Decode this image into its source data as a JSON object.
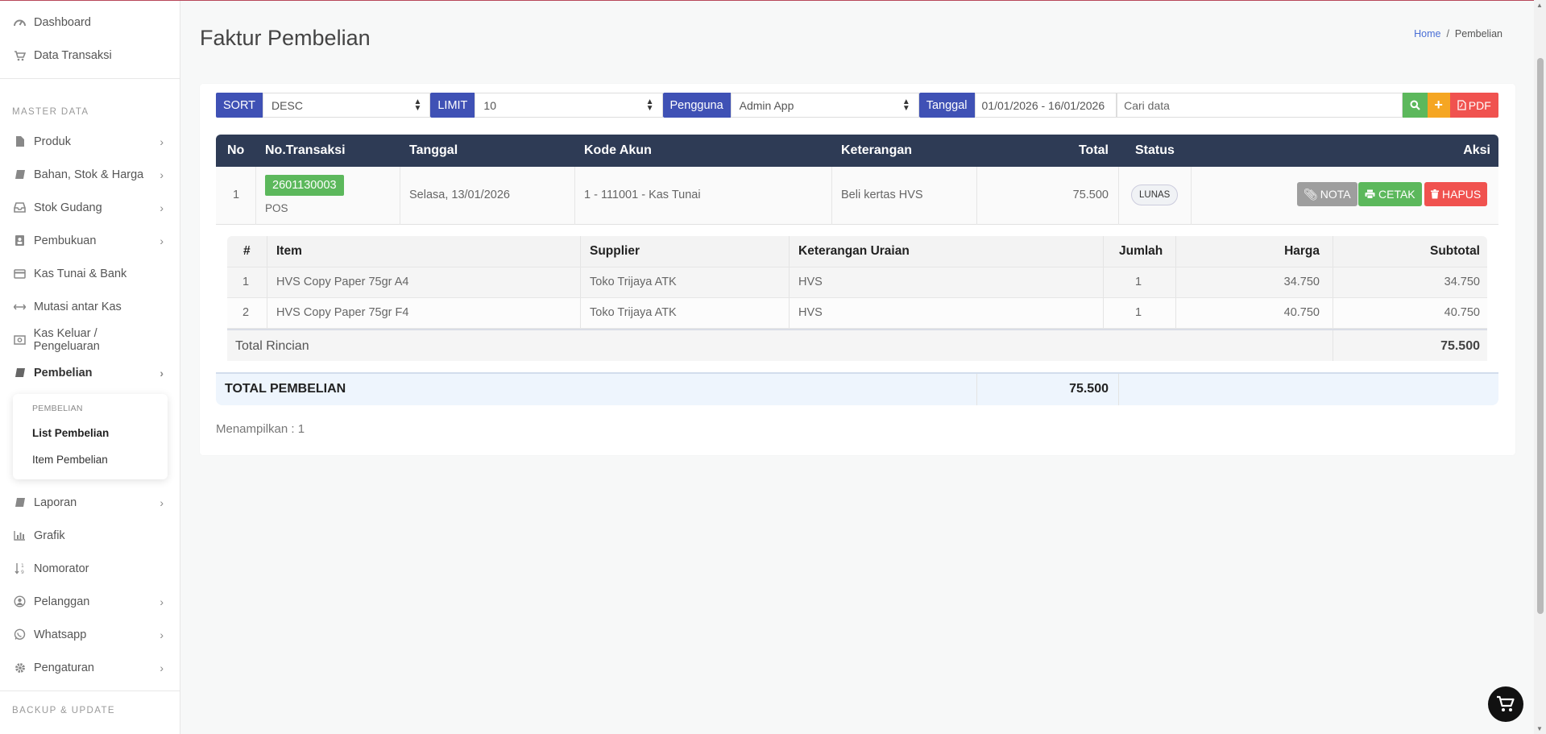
{
  "sidebar": {
    "top_items": [
      {
        "label": "Dashboard",
        "icon": "dashboard-icon"
      },
      {
        "label": "Data Transaksi",
        "icon": "cart-icon"
      }
    ],
    "section_master": "MASTER DATA",
    "master_items": [
      {
        "label": "Produk",
        "icon": "file-icon",
        "has_chevron": true
      },
      {
        "label": "Bahan, Stok & Harga",
        "icon": "book-icon",
        "has_chevron": true
      },
      {
        "label": "Stok Gudang",
        "icon": "inbox-icon",
        "has_chevron": true
      },
      {
        "label": "Pembukuan",
        "icon": "address-book-icon",
        "has_chevron": true
      },
      {
        "label": "Kas Tunai & Bank",
        "icon": "credit-card-icon",
        "has_chevron": false
      },
      {
        "label": "Mutasi antar Kas",
        "icon": "arrows-h-icon",
        "has_chevron": false
      },
      {
        "label": "Kas Keluar / Pengeluaran",
        "icon": "money-icon",
        "has_chevron": false
      },
      {
        "label": "Pembelian",
        "icon": "book-icon",
        "has_chevron": true
      }
    ],
    "submenu": {
      "heading": "PEMBELIAN",
      "items": [
        "List Pembelian",
        "Item Pembelian"
      ]
    },
    "lower_items": [
      {
        "label": "Laporan",
        "icon": "book-icon",
        "has_chevron": true
      },
      {
        "label": "Grafik",
        "icon": "bar-chart-icon",
        "has_chevron": false
      },
      {
        "label": "Nomorator",
        "icon": "sort-numeric-icon",
        "has_chevron": false
      },
      {
        "label": "Pelanggan",
        "icon": "user-circle-icon",
        "has_chevron": true
      },
      {
        "label": "Whatsapp",
        "icon": "whatsapp-icon",
        "has_chevron": true
      },
      {
        "label": "Pengaturan",
        "icon": "gear-icon",
        "has_chevron": true
      }
    ],
    "section_backup": "BACKUP & UPDATE"
  },
  "page": {
    "title": "Faktur Pembelian",
    "breadcrumb_home": "Home",
    "breadcrumb_current": "Pembelian"
  },
  "filters": {
    "sort_label": "SORT",
    "sort_value": "DESC",
    "limit_label": "LIMIT",
    "limit_value": "10",
    "user_label": "Pengguna",
    "user_value": "Admin App",
    "date_label": "Tanggal",
    "date_value": "01/01/2026 - 16/01/2026",
    "search_placeholder": "Cari data",
    "pdf_label": "PDF"
  },
  "table": {
    "headers": {
      "no": "No",
      "trx": "No.Transaksi",
      "date": "Tanggal",
      "account": "Kode Akun",
      "note": "Keterangan",
      "total": "Total",
      "status": "Status",
      "actions": "Aksi"
    },
    "row": {
      "no": "1",
      "trx": "2601130003",
      "source": "POS",
      "date": "Selasa, 13/01/2026",
      "account": "1 - 111001 - Kas Tunai",
      "note": "Beli kertas HVS",
      "total": "75.500",
      "status": "LUNAS",
      "btn_nota": "NOTA",
      "btn_cetak": "CETAK",
      "btn_hapus": "HAPUS"
    }
  },
  "detail": {
    "headers": {
      "idx": "#",
      "item": "Item",
      "supplier": "Supplier",
      "desc": "Keterangan Uraian",
      "qty": "Jumlah",
      "price": "Harga",
      "subtotal": "Subtotal"
    },
    "rows": [
      {
        "idx": "1",
        "item": "HVS Copy Paper 75gr A4",
        "supplier": "Toko Trijaya ATK",
        "desc": "HVS",
        "qty": "1",
        "price": "34.750",
        "subtotal": "34.750"
      },
      {
        "idx": "2",
        "item": "HVS Copy Paper 75gr F4",
        "supplier": "Toko Trijaya ATK",
        "desc": "HVS",
        "qty": "1",
        "price": "40.750",
        "subtotal": "40.750"
      }
    ],
    "total_label": "Total Rincian",
    "total_value": "75.500"
  },
  "grand": {
    "label": "TOTAL PEMBELIAN",
    "value": "75.500"
  },
  "footer": {
    "shown": "Menampilkan : 1"
  },
  "colors": {
    "indigo": "#3f51b5",
    "green": "#5cb85c",
    "orange": "#f5a623",
    "red": "#f0524f",
    "grey": "#9e9e9e",
    "header_dark": "#2e3b55"
  }
}
